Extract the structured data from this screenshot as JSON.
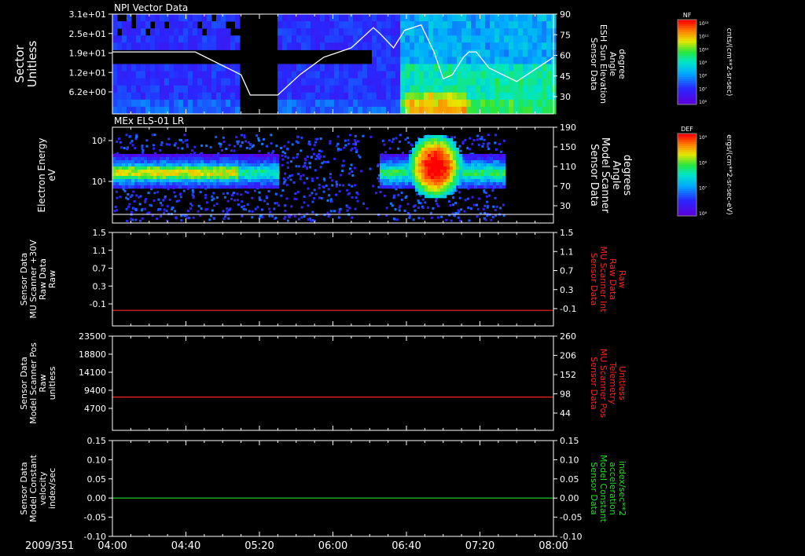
{
  "time_axis": {
    "date_label": "2009/351",
    "ticks": [
      "04:00",
      "04:40",
      "05:20",
      "06:00",
      "06:40",
      "07:20",
      "08:00"
    ]
  },
  "panels": [
    {
      "id": "npi",
      "title": "NPI Vector Data",
      "left_label": [
        "Sector",
        "Unitless"
      ],
      "right_label": [
        "Sensor Data",
        "ESH Sun Elevation",
        "Angle",
        "degree"
      ],
      "right_label_color": "#ffffff",
      "left_ticks": [
        "3.1e+01",
        "2.5e+01",
        "1.9e+01",
        "1.2e+01",
        "6.2e+00"
      ],
      "right_ticks": [
        "90",
        "75",
        "60",
        "45",
        "30"
      ],
      "colorbar": {
        "title": "NF",
        "ticks": [
          "10¹²",
          "10¹¹",
          "10¹⁰",
          "10⁹",
          "10⁸",
          "10⁷",
          "10⁶"
        ],
        "unit": "cnts/(cm**2-sr-sec)"
      }
    },
    {
      "id": "els",
      "title": "MEx ELS-01 LR",
      "left_label": [
        "Electron Energy",
        "eV"
      ],
      "right_label": [
        "Sensor Data",
        "Model Scanner",
        "Angle",
        "degrees"
      ],
      "right_label_color": "#ffffff",
      "left_ticks": [
        "10²",
        "10¹"
      ],
      "right_ticks": [
        "190",
        "150",
        "110",
        "70",
        "30"
      ],
      "colorbar": {
        "title": "DEF",
        "ticks": [
          "10⁹",
          "10⁸",
          "10⁷",
          "10⁶"
        ],
        "unit": "ergs/(cm**2-sr-sec-eV)"
      }
    },
    {
      "id": "mu30v",
      "title": "",
      "left_label": [
        "Sensor Data",
        "MU Scanner +30V",
        "Raw Data",
        "Raw"
      ],
      "right_label": [
        "Sensor Data",
        "MU Scanner Int",
        "Raw Data",
        "Raw"
      ],
      "right_label_color": "#ff2020",
      "left_ticks": [
        "1.5",
        "1.1",
        "0.7",
        "0.3",
        "-0.1"
      ],
      "right_ticks": [
        "1.5",
        "1.1",
        "0.7",
        "0.3",
        "-0.1"
      ]
    },
    {
      "id": "scanpos",
      "title": "",
      "left_label": [
        "Sensor Data",
        "Model Scanner Pos",
        "Raw",
        "unitless"
      ],
      "right_label": [
        "Sensor Data",
        "MU Scanner Pos",
        "Telemetry",
        "Unitless"
      ],
      "right_label_color": "#ff2020",
      "left_ticks": [
        "23500",
        "18800",
        "14100",
        "9400",
        "4700"
      ],
      "right_ticks": [
        "260",
        "206",
        "152",
        "98",
        "44"
      ]
    },
    {
      "id": "velocity",
      "title": "",
      "left_label": [
        "Sensor Data",
        "Model Constant",
        "velocity",
        "index/sec"
      ],
      "right_label": [
        "Sensor Data",
        "Model Constant",
        "acceleration",
        "index/sec**2"
      ],
      "right_label_color": "#22dd22",
      "left_ticks": [
        "0.15",
        "0.10",
        "0.05",
        "0.00",
        "-0.05",
        "-0.10"
      ],
      "right_ticks": [
        "0.15",
        "0.10",
        "0.05",
        "0.00",
        "-0.05",
        "-0.10"
      ]
    }
  ],
  "chart_data": [
    {
      "type": "heatmap",
      "title": "NPI Vector Data",
      "ylabel": "Sector Unitless",
      "y2label": "Sensor Data ESH Sun Elevation Angle degree",
      "xlim": [
        "04:00",
        "08:00"
      ],
      "y2lim": [
        16,
        90
      ],
      "sun_elevation_line": {
        "color": "#ffffff",
        "x": [
          "04:00",
          "04:45",
          "05:10",
          "05:15",
          "05:30",
          "05:42",
          "05:55",
          "06:10",
          "06:22",
          "06:26",
          "06:33",
          "06:39",
          "06:48",
          "06:55",
          "07:00",
          "07:05",
          "07:11",
          "07:14",
          "07:18",
          "07:25",
          "07:40",
          "08:00"
        ],
        "y": [
          62,
          62,
          45,
          30,
          30,
          45,
          58,
          65,
          80,
          75,
          65,
          78,
          82,
          62,
          42,
          45,
          58,
          62,
          62,
          50,
          40,
          58
        ]
      },
      "colorbar": {
        "label": "NF",
        "unit": "cnts/(cm**2-sr-sec)",
        "range": [
          "10⁶",
          "10¹²"
        ]
      }
    },
    {
      "type": "heatmap",
      "title": "MEx ELS-01 LR",
      "ylabel": "Electron Energy eV",
      "y2label": "Sensor Data Model Scanner Angle degrees",
      "xlim": [
        "04:00",
        "08:00"
      ],
      "y2lim": [
        0,
        190
      ],
      "colorbar": {
        "label": "DEF",
        "unit": "ergs/(cm**2-sr-sec-eV)",
        "range": [
          "10⁶",
          "10⁹"
        ]
      }
    },
    {
      "type": "line",
      "ylabel": "Sensor Data MU Scanner +30V Raw Data Raw",
      "y2label": "Sensor Data MU Scanner Int Raw Data Raw",
      "xlim": [
        "04:00",
        "08:00"
      ],
      "ylim": [
        -0.3,
        1.5
      ],
      "series": [
        {
          "name": "Sensor Data MU Scanner Int Raw Data Raw",
          "color": "#ff2020",
          "x": [
            "04:00",
            "08:00"
          ],
          "y": [
            0.0,
            0.0
          ]
        }
      ]
    },
    {
      "type": "line",
      "ylabel": "Sensor Data Model Scanner Pos Raw unitless",
      "y2label": "Sensor Data MU Scanner Pos Telemetry Unitless",
      "xlim": [
        "04:00",
        "08:00"
      ],
      "ylim": [
        0,
        23500
      ],
      "series": [
        {
          "name": "Sensor Data MU Scanner Pos Telemetry Unitless",
          "color": "#ff2020",
          "x": [
            "04:00",
            "08:00"
          ],
          "y": [
            8300,
            8300
          ]
        }
      ]
    },
    {
      "type": "line",
      "ylabel": "Sensor Data Model Constant velocity index/sec",
      "y2label": "Sensor Data Model Constant acceleration index/sec**2",
      "xlim": [
        "04:00",
        "08:00"
      ],
      "ylim": [
        -0.1,
        0.15
      ],
      "series": [
        {
          "name": "Sensor Data Model Constant acceleration index/sec**2",
          "color": "#22dd22",
          "x": [
            "04:00",
            "08:00"
          ],
          "y": [
            0.0,
            0.0
          ]
        }
      ]
    }
  ]
}
